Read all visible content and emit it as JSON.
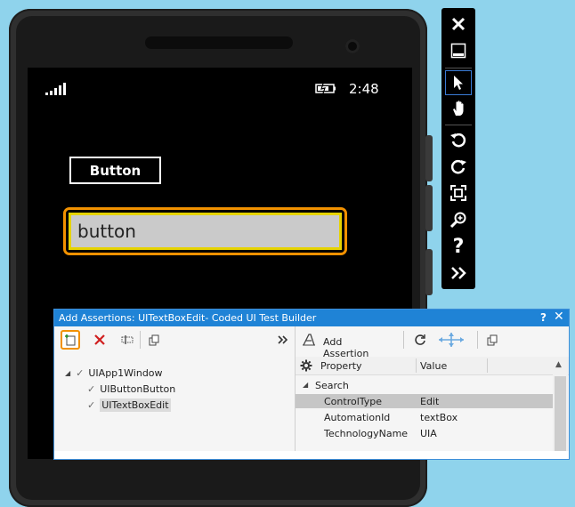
{
  "phone": {
    "clock": "2:48",
    "button_label": "Button",
    "textbox_value": "button"
  },
  "emulator_toolbar": {
    "items": [
      "close-icon",
      "minimize-icon",
      "pointer-icon",
      "hand-icon",
      "rotate-left-icon",
      "rotate-right-icon",
      "fit-screen-icon",
      "zoom-icon",
      "help-icon",
      "expand-icon"
    ],
    "help_label": "?"
  },
  "builder": {
    "title": "Add Assertions: UITextBoxEdit- Coded UI Test Builder",
    "help": "?",
    "close": "✕",
    "add_assertion_label": "Add Assertion",
    "tree": [
      {
        "label": "UIApp1Window"
      },
      {
        "label": "UIButtonButton"
      },
      {
        "label": "UITextBoxEdit"
      }
    ],
    "grid": {
      "col_property": "Property",
      "col_value": "Value",
      "group": "Search",
      "rows": [
        {
          "property": "ControlType",
          "value": "Edit"
        },
        {
          "property": "AutomationId",
          "value": "textBox"
        },
        {
          "property": "TechnologyName",
          "value": "UIA"
        }
      ]
    },
    "colors": {
      "titlebar": "#1f83d6",
      "highlight": "#f29100"
    }
  }
}
